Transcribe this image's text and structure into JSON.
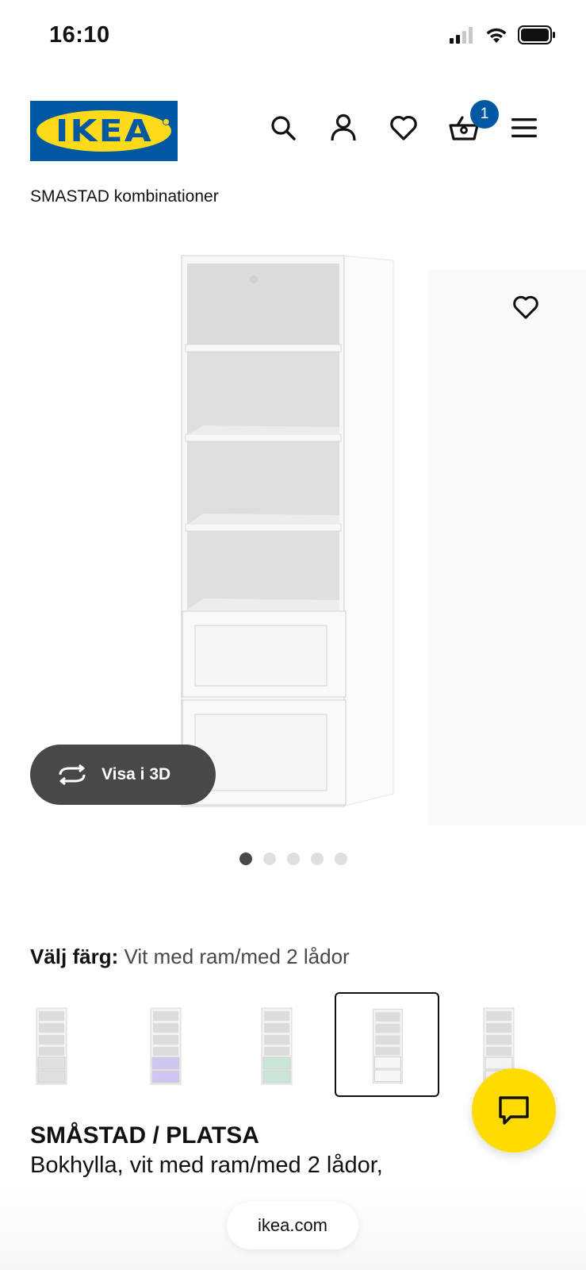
{
  "status_bar": {
    "time": "16:10"
  },
  "header": {
    "logo_text": "IKEA",
    "cart_count": "1"
  },
  "breadcrumb": "SMASTAD kombinationer",
  "gallery": {
    "view_3d_label": "Visa i 3D",
    "dots_total": 5,
    "active_dot": 1
  },
  "color_selector": {
    "label": "Välj färg:",
    "value": "Vit med ram/med 2 lådor",
    "swatches": [
      {
        "name": "white-grey",
        "drawer_color": "#e0e0e0",
        "selected": false
      },
      {
        "name": "lilac",
        "drawer_color": "#cfc6f0",
        "selected": false
      },
      {
        "name": "mint",
        "drawer_color": "#c9e6d6",
        "selected": false
      },
      {
        "name": "white-frame",
        "drawer_color": "#f6f6f6",
        "selected": true
      },
      {
        "name": "white",
        "drawer_color": "#f4f4f4",
        "selected": false
      }
    ]
  },
  "product": {
    "name": "SMÅSTAD / PLATSA",
    "description": "Bokhylla, vit med ram/med 2 lådor,"
  },
  "browser": {
    "url": "ikea.com"
  },
  "colors": {
    "ikea_blue": "#0058a3",
    "ikea_yellow": "#ffda1a",
    "chat_yellow": "#ffdb00",
    "dark_grey": "#484848"
  }
}
